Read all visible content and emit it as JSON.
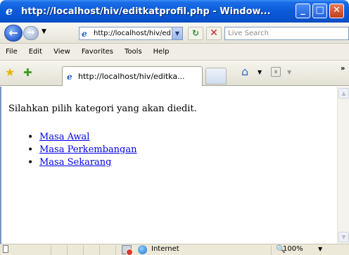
{
  "window": {
    "title": "http://localhost/hiv/editkatprofil.php - Window...",
    "minimize": "_",
    "maximize": "□",
    "close": "✕"
  },
  "address": {
    "url": "http://localhost/hiv/edi",
    "search_placeholder": "Live Search"
  },
  "menu": {
    "items": [
      "File",
      "Edit",
      "View",
      "Favorites",
      "Tools",
      "Help"
    ]
  },
  "tab": {
    "label": "http://localhost/hiv/editka..."
  },
  "page": {
    "intro": "Silahkan pilih kategori yang akan diedit.",
    "categories": [
      "Masa Awal",
      "Masa Perkembangan",
      "Masa Sekarang"
    ]
  },
  "status": {
    "zone": "Internet",
    "zoom": "100%"
  },
  "icons": {
    "back": "back-arrow-icon",
    "forward": "forward-arrow-icon",
    "refresh": "refresh-icon",
    "stop": "stop-icon",
    "favorites": "star-icon",
    "add_favorite": "add-favorite-icon",
    "home": "home-icon",
    "feeds": "feed-icon"
  },
  "colors": {
    "titlebar": "#0a5ad8",
    "link": "#0000ee",
    "close_button": "#c33d17"
  }
}
